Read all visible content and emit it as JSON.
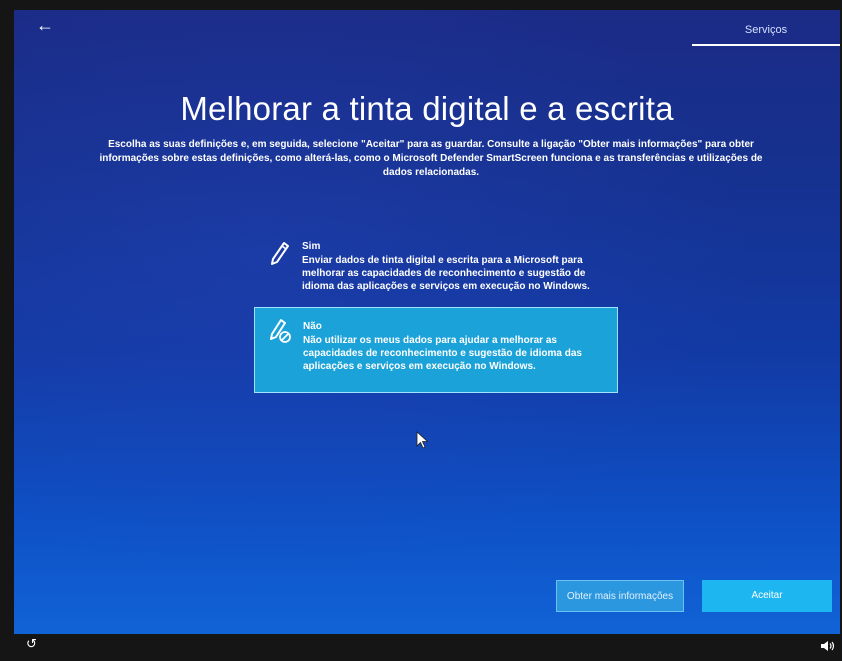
{
  "header": {
    "back_icon": "arrow-left-icon",
    "active_tab": "Serviços"
  },
  "page": {
    "title": "Melhorar a tinta digital e a escrita",
    "subtitle": "Escolha as suas definições e, em seguida, selecione \"Aceitar\" para as guardar. Consulte a ligação \"Obter mais informações\" para obter informações sobre estas definições, como alterá-las, como o Microsoft Defender SmartScreen funciona e as transferências e utilizações de dados relacionadas."
  },
  "options": [
    {
      "title": "Sim",
      "description": "Enviar dados de tinta digital e escrita para a Microsoft para melhorar as capacidades de reconhecimento e sugestão de idioma das aplicações e serviços em execução no Windows.",
      "icon": "pen-icon",
      "selected": false
    },
    {
      "title": "Não",
      "description": "Não utilizar os meus dados para ajudar a melhorar as capacidades de reconhecimento e sugestão de idioma das aplicações e serviços em execução no Windows.",
      "icon": "pen-blocked-icon",
      "selected": true
    }
  ],
  "buttons": {
    "more_info": "Obter mais informações",
    "accept": "Aceitar"
  },
  "footer": {
    "left_icon": "ease-of-access-icon",
    "right_icon": "volume-icon"
  },
  "colors": {
    "background_top": "#1b2b86",
    "background_bottom": "#1063d6",
    "selected_option": "#1ba2d8",
    "accept_button": "#1eb6f0"
  }
}
